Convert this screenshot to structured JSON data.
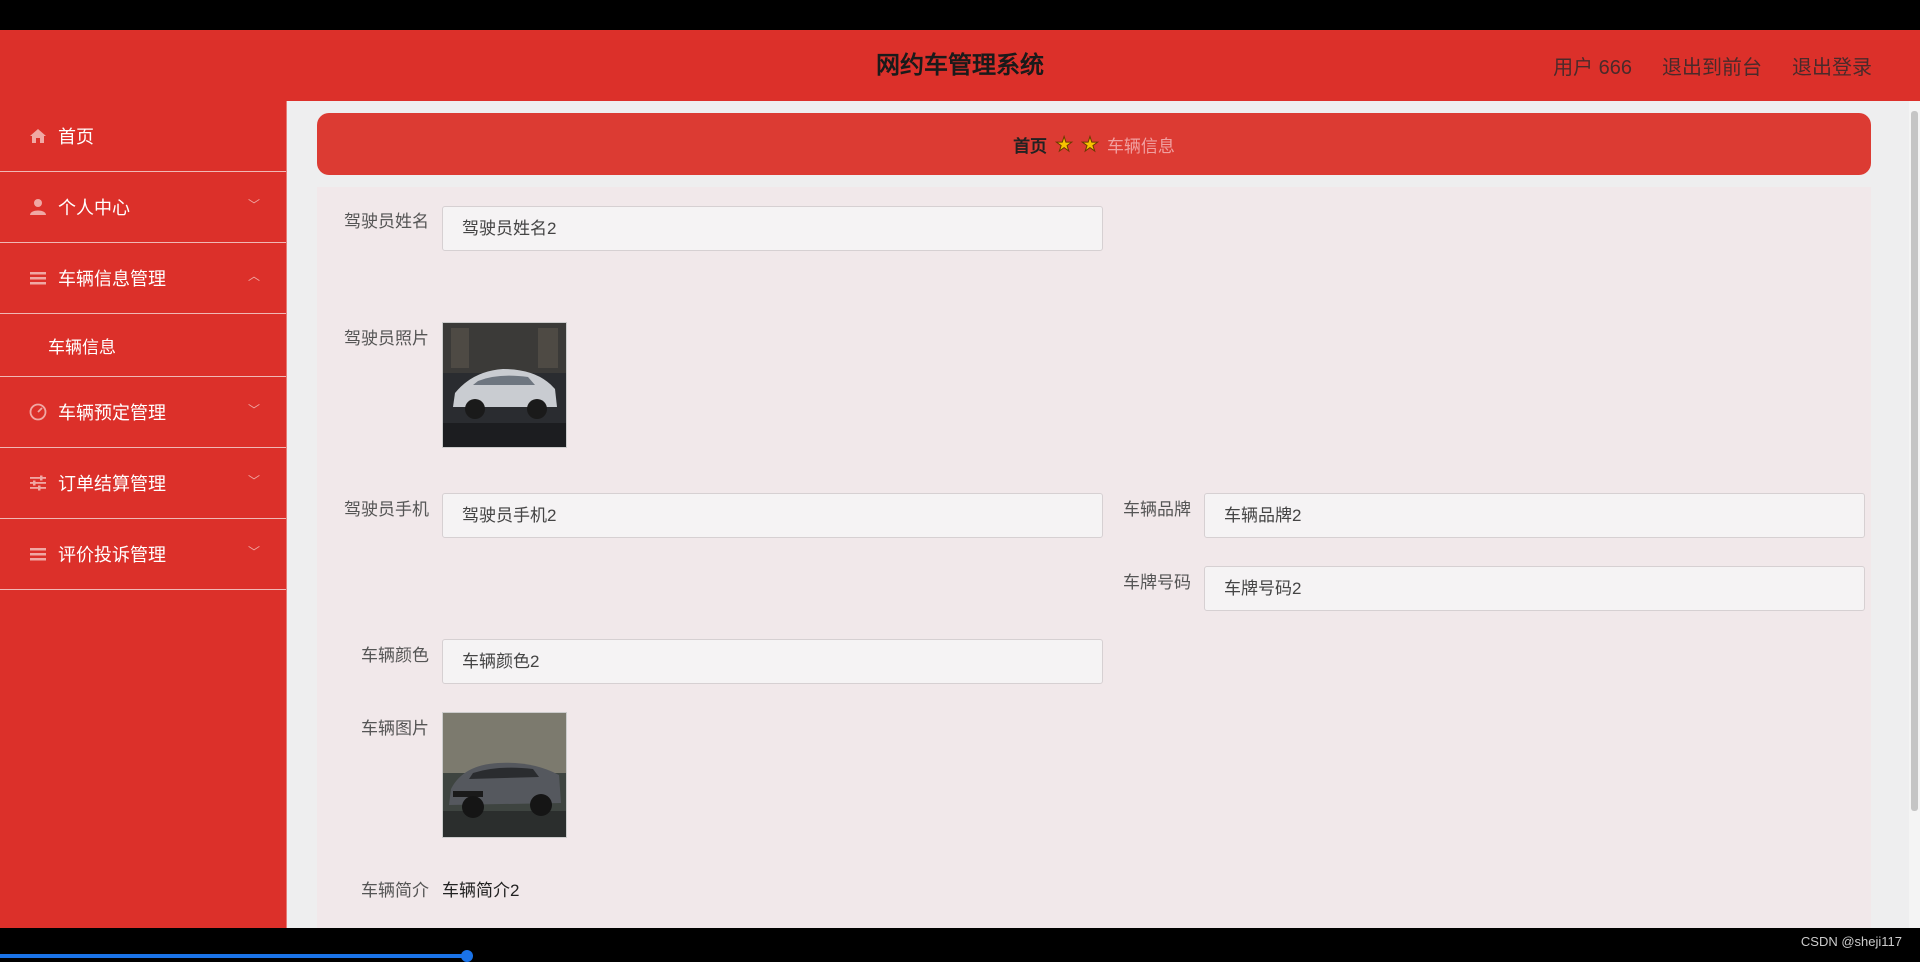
{
  "header": {
    "title": "网约车管理系统",
    "user": "用户 666",
    "to_front": "退出到前台",
    "logout": "退出登录"
  },
  "sidebar": {
    "items": [
      {
        "label": "首页",
        "icon": "home-icon"
      },
      {
        "label": "个人中心",
        "icon": "user-icon"
      },
      {
        "label": "车辆信息管理",
        "icon": "menu-icon"
      },
      {
        "label": "车辆预定管理",
        "icon": "gauge-icon"
      },
      {
        "label": "订单结算管理",
        "icon": "sliders-icon"
      },
      {
        "label": "评价投诉管理",
        "icon": "menu-icon"
      }
    ],
    "sub_item": "车辆信息"
  },
  "breadcrumb": {
    "home": "首页",
    "current": "车辆信息"
  },
  "form": {
    "driver_name_label": "驾驶员姓名",
    "driver_name": "驾驶员姓名2",
    "driver_photo_label": "驾驶员照片",
    "driver_phone_label": "驾驶员手机",
    "driver_phone": "驾驶员手机2",
    "brand_label": "车辆品牌",
    "brand": "车辆品牌2",
    "plate_label": "车牌号码",
    "plate": "车牌号码2",
    "color_label": "车辆颜色",
    "color": "车辆颜色2",
    "car_image_label": "车辆图片",
    "intro_label": "车辆简介",
    "intro": "车辆简介2"
  },
  "watermark": "CSDN @sheji117",
  "colors": {
    "primary_red": "#dc302a",
    "form_bg": "#f1e8ea"
  }
}
